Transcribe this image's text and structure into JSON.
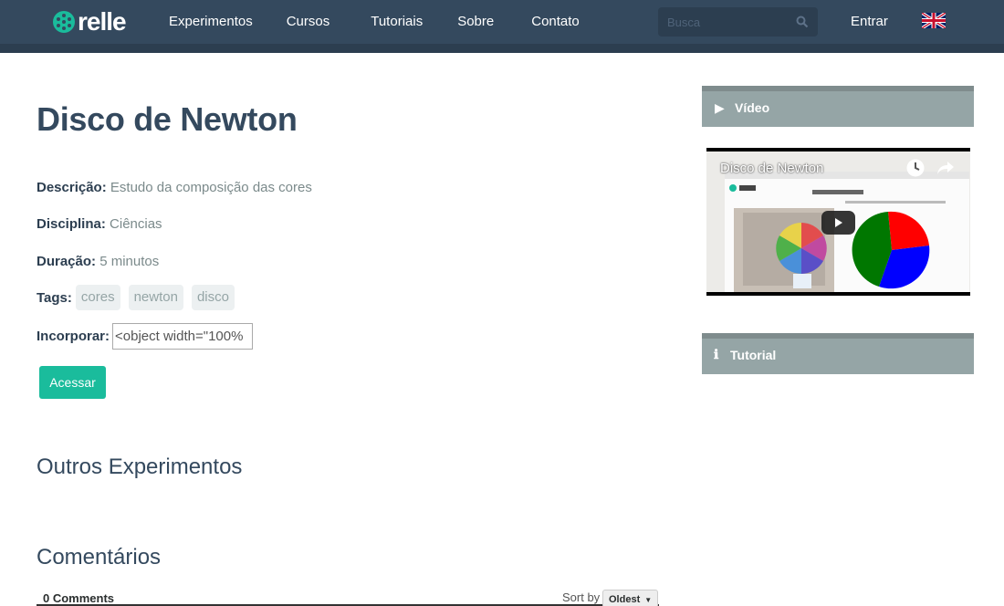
{
  "nav": {
    "brand": "relle",
    "links": [
      "Experimentos",
      "Cursos",
      "Tutoriais",
      "Sobre",
      "Contato"
    ],
    "search_placeholder": "Busca",
    "login": "Entrar"
  },
  "experiment": {
    "title": "Disco de Newton",
    "description_label": "Descrição:",
    "description": "Estudo da composição das cores",
    "discipline_label": "Disciplina:",
    "discipline": "Ciências",
    "duration_label": "Duração:",
    "duration": "5 minutos",
    "tags_label": "Tags:",
    "tags": [
      "cores",
      "newton",
      "disco"
    ],
    "embed_label": "Incorporar:",
    "embed_value": "<object width=\"100%",
    "access_button": "Acessar"
  },
  "sections": {
    "others": "Outros Experimentos",
    "comments": "Comentários"
  },
  "comments": {
    "count": "0 Comments",
    "sort_label": "Sort by",
    "sort_value": "Oldest"
  },
  "sidebar": {
    "video_label": "Vídeo",
    "video_title": "Disco de Newton",
    "tutorial_label": "Tutorial"
  },
  "colors": {
    "navbar": "#34495e",
    "accent": "#1abc9c",
    "panel": "#95a5a6"
  }
}
